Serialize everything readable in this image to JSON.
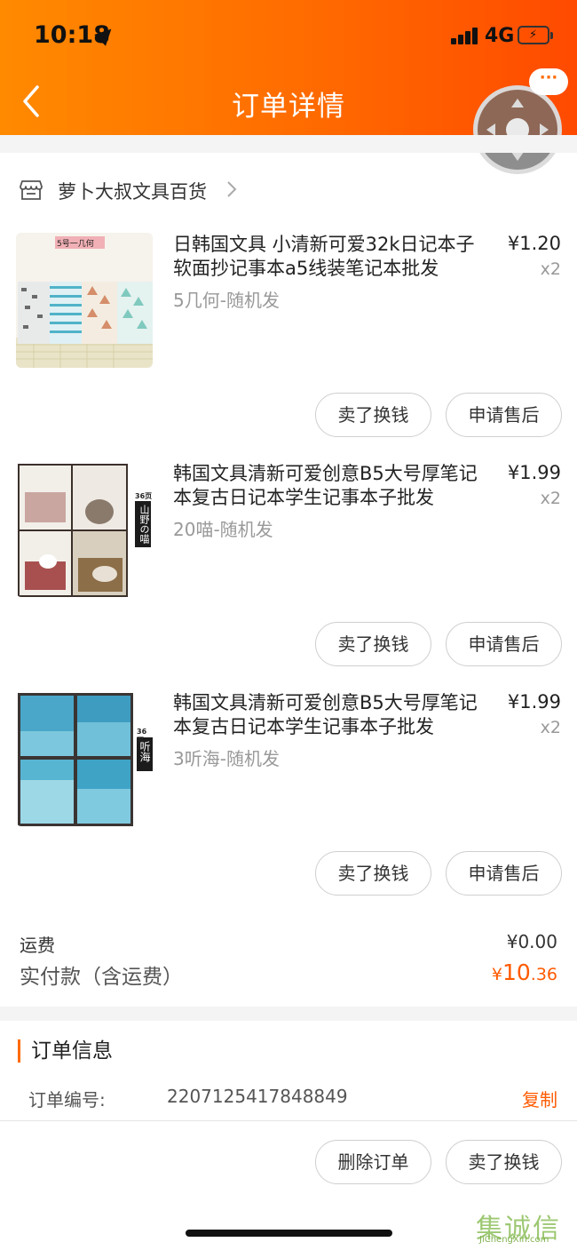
{
  "status_bar": {
    "time": "10:18",
    "network": "4G"
  },
  "header": {
    "title": "订单详情"
  },
  "shop": {
    "name": "萝卜大叔文具百货"
  },
  "items": [
    {
      "title": "日韩国文具 小清新可爱32k日记本子软面抄记事本a5线装笔记本批发",
      "spec": "5几何-随机发",
      "price": "¥1.20",
      "qty": "x2",
      "thumb_label": "5号一几何",
      "buttons": [
        "卖了换钱",
        "申请售后"
      ]
    },
    {
      "title": "韩国文具清新可爱创意B5大号厚笔记本复古日记本学生记事本子批发",
      "spec": "20喵-随机发",
      "price": "¥1.99",
      "qty": "x2",
      "thumb_tag_top": "36页",
      "thumb_tag": "山野の喵",
      "buttons": [
        "卖了换钱",
        "申请售后"
      ]
    },
    {
      "title": "韩国文具清新可爱创意B5大号厚笔记本复古日记本学生记事本子批发",
      "spec": "3听海-随机发",
      "price": "¥1.99",
      "qty": "x2",
      "thumb_tag_top": "36页",
      "thumb_tag": "听海",
      "buttons": [
        "卖了换钱",
        "申请售后"
      ]
    }
  ],
  "totals": {
    "shipping_label": "运费",
    "shipping_value": "¥0.00",
    "paid_label": "实付款（含运费）",
    "paid_currency": "¥",
    "paid_integer": "10",
    "paid_decimal": ".36"
  },
  "order_info": {
    "title": "订单信息",
    "order_no_label": "订单编号:",
    "order_no": "2207125417848849",
    "copy_label": "复制"
  },
  "footer": {
    "buttons": [
      "删除订单",
      "卖了换钱"
    ]
  },
  "watermark": {
    "text": "集诚信",
    "url": "JiChengXin.com"
  },
  "colors": {
    "accent": "#ff5a00",
    "header_start": "#ff8a00",
    "header_end": "#ff4a00"
  }
}
